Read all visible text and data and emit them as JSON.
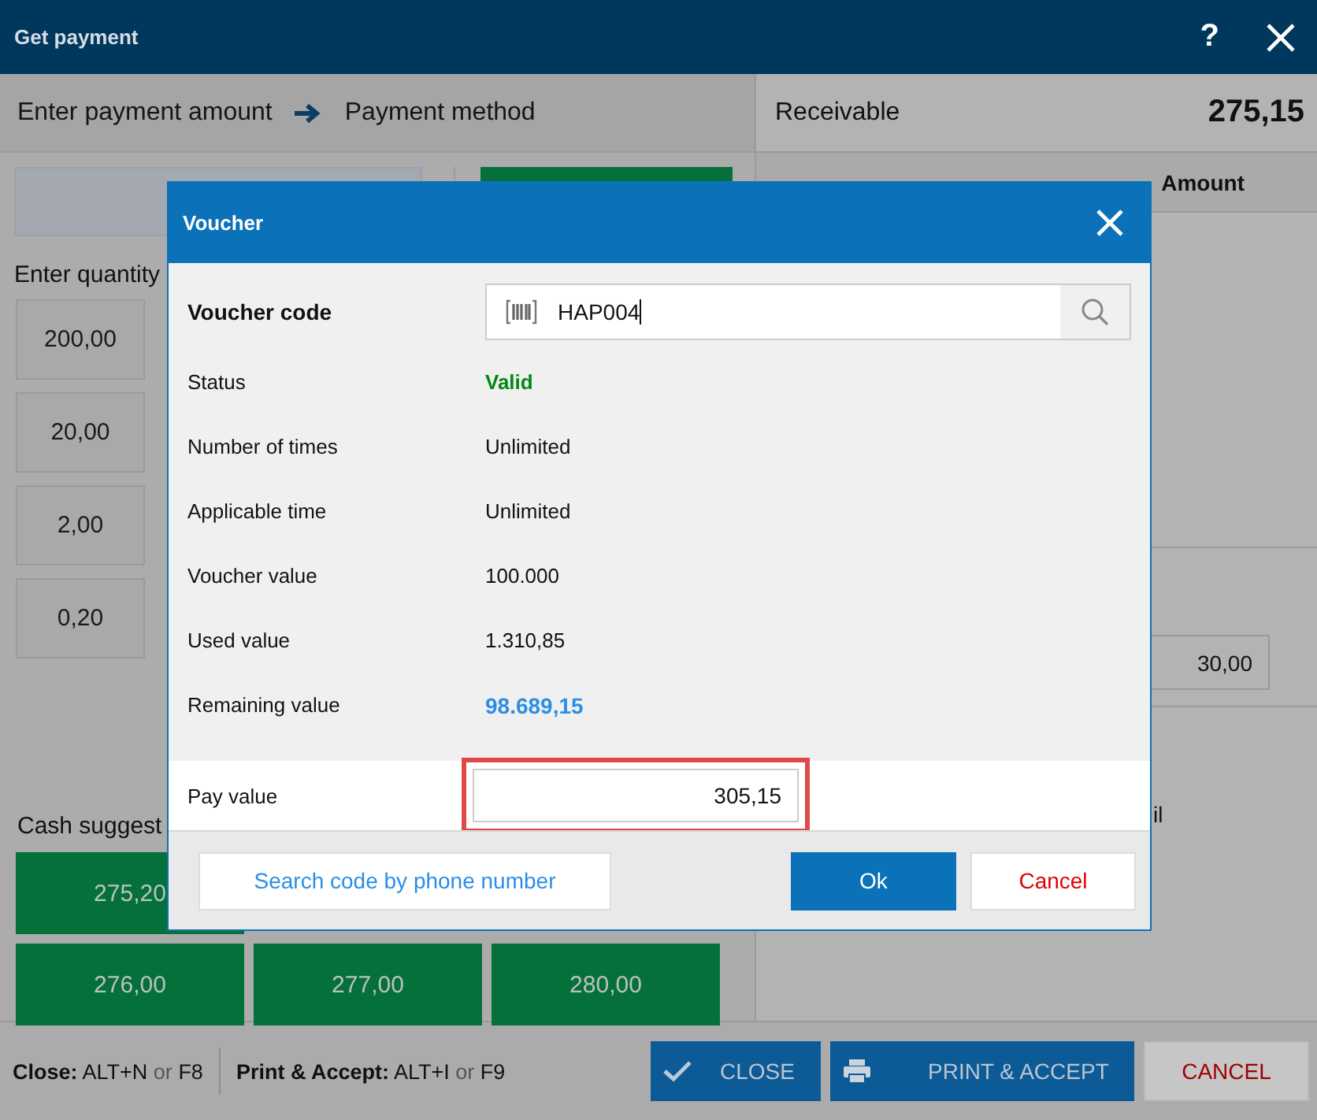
{
  "window": {
    "title": "Get payment",
    "help": "?"
  },
  "steps": [
    "Enter payment amount",
    "Payment method"
  ],
  "left": {
    "quantity_label": "Enter quantity",
    "quantity_buttons": [
      "200,00",
      "20,00",
      "2,00",
      "0,20"
    ],
    "cash_label": "Cash suggest",
    "cash_buttons": [
      "275,20",
      "276,00",
      "277,00",
      "280,00"
    ]
  },
  "right": {
    "receivable_label": "Receivable",
    "receivable": "275,15",
    "amount_header": "Amount",
    "amount_field": "30,00",
    "fragment": "il"
  },
  "voucher_dialog": {
    "title": "Voucher",
    "code_label": "Voucher code",
    "code_value": "HAP004",
    "fields": [
      {
        "label": "Status",
        "value": "Valid",
        "kind": "status"
      },
      {
        "label": "Number of times",
        "value": "Unlimited",
        "kind": "plain"
      },
      {
        "label": "Applicable time",
        "value": "Unlimited",
        "kind": "plain"
      },
      {
        "label": "Voucher value",
        "value": "100.000",
        "kind": "plain"
      },
      {
        "label": "Used value",
        "value": "1.310,85",
        "kind": "plain"
      },
      {
        "label": "Remaining value",
        "value": "98.689,15",
        "kind": "highlight"
      }
    ],
    "pay_label": "Pay value",
    "pay_value": "305,15",
    "search_link": "Search code by phone number",
    "ok": "Ok",
    "cancel": "Cancel"
  },
  "shortcuts": [
    {
      "label": "Close:",
      "key": "ALT+N",
      "or": "or",
      "alt": "F8"
    },
    {
      "label": "Print & Accept:",
      "key": "ALT+I",
      "or": "or",
      "alt": "F9"
    }
  ],
  "buttons": [
    {
      "label": "CLOSE",
      "kind": "close"
    },
    {
      "label": "PRINT & ACCEPT",
      "kind": "print"
    },
    {
      "label": "CANCEL",
      "kind": "cancel"
    }
  ]
}
